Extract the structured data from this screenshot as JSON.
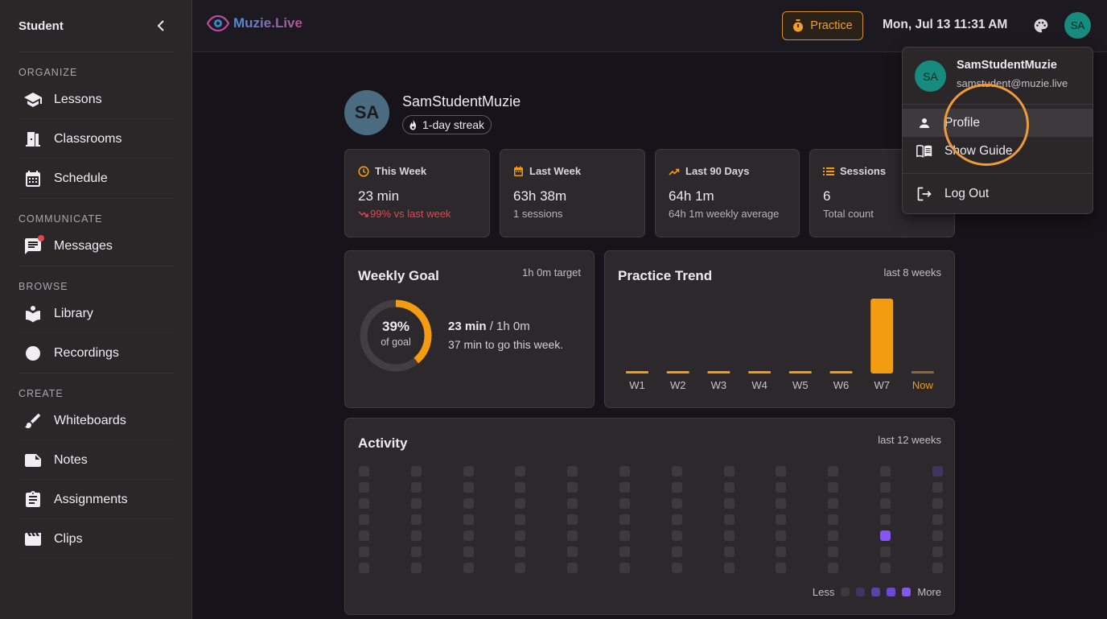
{
  "sidebar": {
    "title": "Student",
    "sections": [
      {
        "label": "ORGANIZE",
        "items": [
          {
            "label": "Lessons",
            "icon": "school-icon"
          },
          {
            "label": "Classrooms",
            "icon": "door-icon"
          },
          {
            "label": "Schedule",
            "icon": "calendar-icon"
          }
        ]
      },
      {
        "label": "COMMUNICATE",
        "items": [
          {
            "label": "Messages",
            "icon": "chat-icon",
            "badge": true
          }
        ]
      },
      {
        "label": "BROWSE",
        "items": [
          {
            "label": "Library",
            "icon": "book-reader-icon"
          },
          {
            "label": "Recordings",
            "icon": "record-icon"
          }
        ]
      },
      {
        "label": "CREATE",
        "items": [
          {
            "label": "Whiteboards",
            "icon": "brush-icon"
          },
          {
            "label": "Notes",
            "icon": "note-icon"
          },
          {
            "label": "Assignments",
            "icon": "clipboard-icon"
          },
          {
            "label": "Clips",
            "icon": "clapperboard-icon"
          }
        ]
      }
    ]
  },
  "topbar": {
    "logo": "Muzie.Live",
    "practice_label": "Practice",
    "datetime": "Mon, Jul 13 11:31 AM",
    "avatar_initials": "SA"
  },
  "profile": {
    "initials": "SA",
    "name": "SamStudentMuzie",
    "streak": "1-day streak"
  },
  "stats": [
    {
      "label": "This Week",
      "value": "23 min",
      "sub": "99% vs last week",
      "icon": "clock-icon"
    },
    {
      "label": "Last Week",
      "value": "63h 38m",
      "sub": "1 sessions",
      "icon": "calendar-icon"
    },
    {
      "label": "Last 90 Days",
      "value": "64h 1m",
      "sub": "64h 1m weekly average",
      "icon": "trending-up-icon"
    },
    {
      "label": "Sessions",
      "value": "6",
      "sub": "Total count",
      "icon": "list-icon"
    }
  ],
  "weekly_goal": {
    "title": "Weekly Goal",
    "target": "1h 0m target",
    "percent_label": "39%",
    "percent": 0.39,
    "of_goal": "of goal",
    "current": "23 min",
    "total": " / 1h 0m",
    "remaining": "37 min to go this week."
  },
  "practice_trend": {
    "title": "Practice Trend",
    "range": "last 8 weeks"
  },
  "chart_data": {
    "type": "bar",
    "categories": [
      "W1",
      "W2",
      "W3",
      "W4",
      "W5",
      "W6",
      "W7",
      "Now"
    ],
    "values": [
      0,
      0,
      0,
      0,
      0,
      0,
      63.63,
      0.38
    ],
    "ylabel": "",
    "xlabel": "",
    "colors": {
      "bar": "#f39c12",
      "now_label": "#f39c12",
      "label": "#c8c4c9"
    }
  },
  "activity": {
    "title": "Activity",
    "range": "last 12 weeks",
    "legend_less": "Less",
    "legend_more": "More",
    "levels": [
      "#3d393d",
      "#3f3561",
      "#5c44a6",
      "#7148d6",
      "#8755ef"
    ],
    "weeks": [
      [
        0,
        0,
        0,
        0,
        0,
        0,
        0
      ],
      [
        0,
        0,
        0,
        0,
        0,
        0,
        0
      ],
      [
        0,
        0,
        0,
        0,
        0,
        0,
        0
      ],
      [
        0,
        0,
        0,
        0,
        0,
        0,
        0
      ],
      [
        0,
        0,
        0,
        0,
        0,
        0,
        0
      ],
      [
        0,
        0,
        0,
        0,
        0,
        0,
        0
      ],
      [
        0,
        0,
        0,
        0,
        0,
        0,
        0
      ],
      [
        0,
        0,
        0,
        0,
        0,
        0,
        0
      ],
      [
        0,
        0,
        0,
        0,
        0,
        0,
        0
      ],
      [
        0,
        0,
        0,
        0,
        0,
        0,
        0
      ],
      [
        0,
        0,
        0,
        0,
        4,
        0,
        0
      ],
      [
        1,
        0,
        0,
        0,
        0,
        0,
        0
      ]
    ]
  },
  "dropdown": {
    "initials": "SA",
    "name": "SamStudentMuzie",
    "email": "samstudent@muzie.live",
    "items": [
      {
        "label": "Profile",
        "icon": "person-icon"
      },
      {
        "label": "Show Guide",
        "icon": "menu-book-icon"
      },
      {
        "label": "Log Out",
        "icon": "logout-icon"
      }
    ]
  },
  "colors": {
    "accent": "#f39c12",
    "teal_avatar": "#178b7e",
    "negative": "#e2484f"
  }
}
